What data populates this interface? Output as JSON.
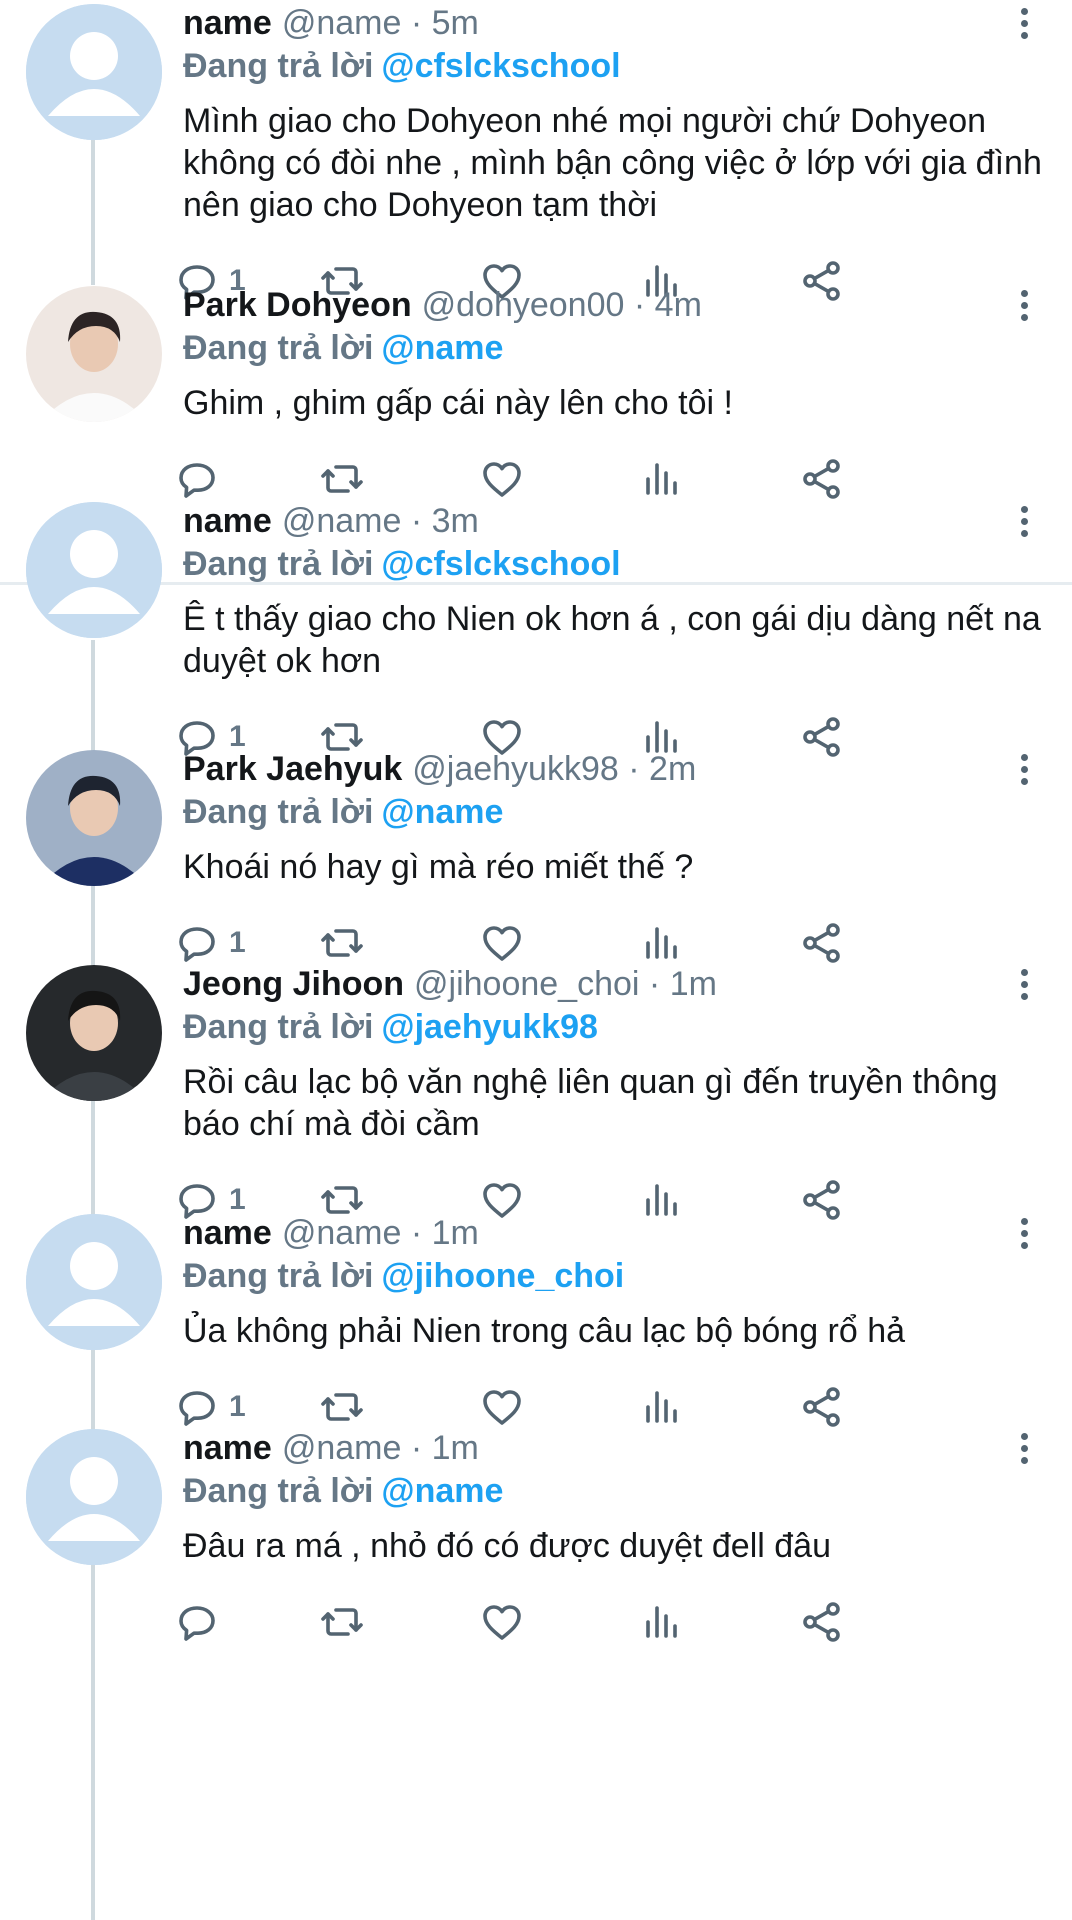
{
  "colors": {
    "accent": "#1da1f2",
    "secondary_text": "#657786",
    "primary_text": "#14171a",
    "thread_line": "#cfd9de",
    "icon": "#536471",
    "default_avatar_bg": "#c6dcf0",
    "default_avatar_fg": "#5b86bf"
  },
  "icons": {
    "reply": "reply-icon",
    "retweet": "retweet-icon",
    "like": "heart-icon",
    "views": "analytics-icon",
    "share": "share-icon",
    "more": "more-vertical-icon"
  },
  "tweets": [
    {
      "avatar": "default-avatar",
      "display_name": "name",
      "handle": "@name",
      "dot": "·",
      "time": "5m",
      "reply_prefix": "Đang trả lời",
      "reply_to": "@cfslckschool",
      "text": "Mình giao cho Dohyeon nhé mọi người chứ Dohyeon không có đòi nhe , mình bận công việc ở lớp với gia đình nên giao cho Dohyeon tạm thời",
      "reply_count": "1"
    },
    {
      "avatar": "photo-park-dohyeon",
      "display_name": "Park Dohyeon",
      "handle": "@dohyeon00",
      "dot": "·",
      "time": "4m",
      "reply_prefix": "Đang trả lời",
      "reply_to": "@name",
      "text": "Ghim , ghim gấp cái này lên cho tôi !",
      "reply_count": ""
    },
    {
      "avatar": "default-avatar",
      "display_name": "name",
      "handle": "@name",
      "dot": "·",
      "time": "3m",
      "reply_prefix": "Đang trả lời",
      "reply_to": "@cfslckschool",
      "text": "Ê t thấy giao cho Nien ok hơn á , con gái dịu dàng nết na duyệt ok hơn",
      "reply_count": "1"
    },
    {
      "avatar": "photo-park-jaehyuk",
      "display_name": "Park Jaehyuk",
      "handle": "@jaehyukk98",
      "dot": "·",
      "time": "2m",
      "reply_prefix": "Đang trả lời",
      "reply_to": "@name",
      "text": "Khoái nó hay gì mà réo miết thế ?",
      "reply_count": "1"
    },
    {
      "avatar": "photo-jeong-jihoon",
      "display_name": "Jeong Jihoon",
      "handle": "@jihoone_choi",
      "dot": "·",
      "time": "1m",
      "reply_prefix": "Đang trả lời",
      "reply_to": "@jaehyukk98",
      "text": "Rồi câu lạc bộ văn nghệ liên quan gì đến truyền thông báo chí mà đòi cầm",
      "reply_count": "1"
    },
    {
      "avatar": "default-avatar",
      "display_name": "name",
      "handle": "@name",
      "dot": "·",
      "time": "1m",
      "reply_prefix": "Đang trả lời",
      "reply_to": "@jihoone_choi",
      "text": "Ủa không phải Nien trong câu lạc bộ bóng rổ hả",
      "reply_count": "1"
    },
    {
      "avatar": "default-avatar",
      "display_name": "name",
      "handle": "@name",
      "dot": "·",
      "time": "1m",
      "reply_prefix": "Đang trả lời",
      "reply_to": "@name",
      "text": "Đâu ra má , nhỏ đó có được duyệt đell đâu",
      "reply_count": ""
    }
  ]
}
